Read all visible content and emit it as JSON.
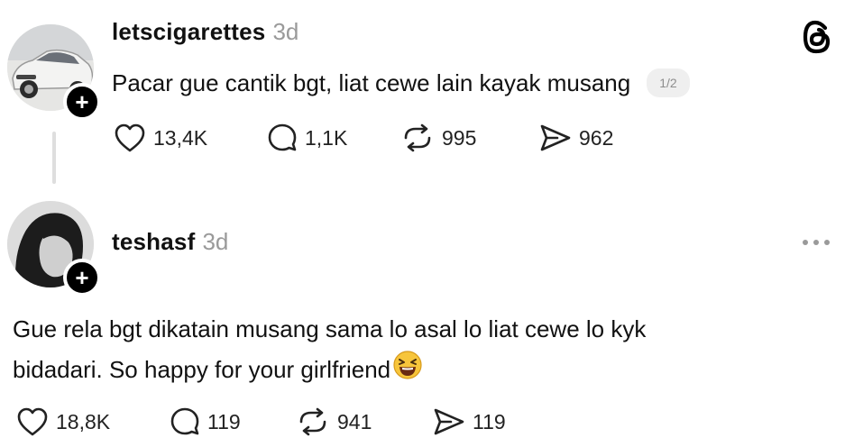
{
  "post": {
    "username": "letscigarettes",
    "time": "3d",
    "text": "Pacar gue cantik bgt, liat cewe lain kayak musang",
    "pager": "1/2",
    "stats": {
      "likes": "13,4K",
      "replies": "1,1K",
      "reposts": "995",
      "shares": "962"
    }
  },
  "reply": {
    "username": "teshasf",
    "time": "3d",
    "text_line1": "Gue rela bgt dikatain musang sama lo asal lo liat cewe lo kyk",
    "text_line2": "bidadari. So happy for your girlfriend",
    "emoji": "laughing-face",
    "stats": {
      "likes": "18,8K",
      "replies": "119",
      "reposts": "941",
      "shares": "119"
    }
  },
  "icons": {
    "app_logo": "threads-logo-icon",
    "like": "heart-icon",
    "reply": "comment-icon",
    "repost": "repost-icon",
    "share": "send-icon",
    "more": "more-dots-icon",
    "follow": "plus-icon"
  },
  "colors": {
    "muted": "#9a9a9a",
    "text": "#111111",
    "badge": "#000000"
  }
}
